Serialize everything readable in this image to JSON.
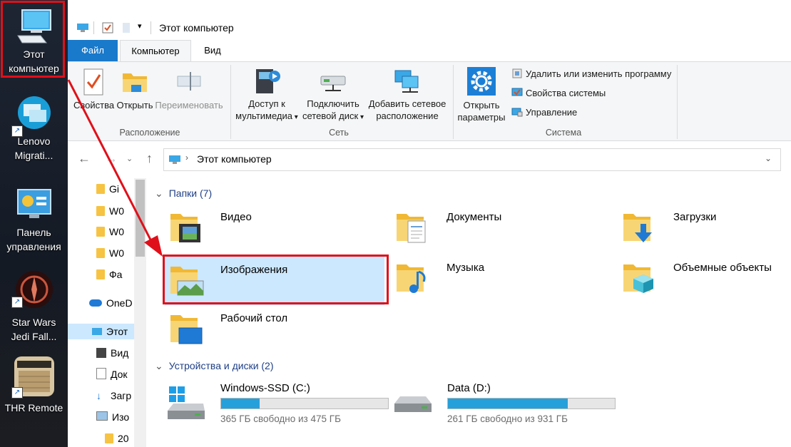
{
  "desktop": {
    "icons": [
      {
        "label_1": "Этот",
        "label_2": "компьютер"
      },
      {
        "label_1": "Lenovo",
        "label_2": "Migrati..."
      },
      {
        "label_1": "Панель",
        "label_2": "управления"
      },
      {
        "label_1": "Star Wars",
        "label_2": "Jedi Fall..."
      },
      {
        "label_1": "THR Remote",
        "label_2": ""
      }
    ]
  },
  "titlebar": {
    "title": "Этот компьютер"
  },
  "tabs": {
    "file": "Файл",
    "computer": "Компьютер",
    "view": "Вид"
  },
  "ribbon": {
    "location": {
      "label": "Расположение",
      "properties": "Свойства",
      "open": "Открыть",
      "rename": "Переименовать"
    },
    "network": {
      "label": "Сеть",
      "media_1": "Доступ к",
      "media_2": "мультимедиа",
      "map_1": "Подключить",
      "map_2": "сетевой диск",
      "addloc_1": "Добавить сетевое",
      "addloc_2": "расположение"
    },
    "system": {
      "label": "Система",
      "settings_1": "Открыть",
      "settings_2": "параметры",
      "uninstall": "Удалить или изменить программу",
      "sysprops": "Свойства системы",
      "manage": "Управление"
    }
  },
  "address": {
    "path": "Этот компьютер"
  },
  "navpane": {
    "items": [
      "Gi",
      "W0",
      "W0",
      "W0",
      "Фа",
      "OneD",
      "Этот",
      "Вид",
      "Док",
      "Загр",
      "Изо",
      "20"
    ]
  },
  "folders": {
    "header": "Папки (7)",
    "items": [
      "Видео",
      "Документы",
      "Загрузки",
      "Изображения",
      "Музыка",
      "Объемные объекты",
      "Рабочий стол"
    ]
  },
  "drives": {
    "header": "Устройства и диски (2)",
    "items": [
      {
        "name": "Windows-SSD (C:)",
        "free": "365 ГБ свободно из 475 ГБ",
        "used_fraction": 0.23
      },
      {
        "name": "Data (D:)",
        "free": "261 ГБ свободно из 931 ГБ",
        "used_fraction": 0.72
      }
    ]
  },
  "colors": {
    "accent": "#1979ca",
    "selection": "#cce8ff",
    "highlight_border": "#e0101a",
    "drive_bar": "#26a0da"
  }
}
